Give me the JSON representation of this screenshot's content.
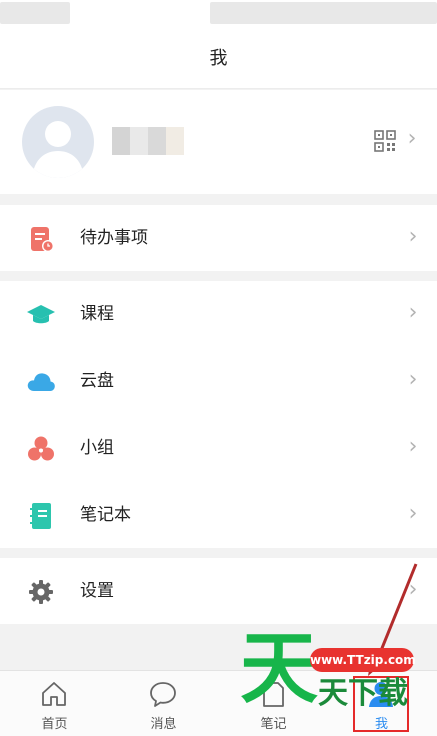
{
  "header": {
    "title": "我"
  },
  "profile": {
    "qr_icon": "qr-code-icon"
  },
  "menu": {
    "todo": {
      "label": "待办事项",
      "icon": "todo-icon",
      "color": "#ef7369"
    },
    "course": {
      "label": "课程",
      "icon": "graduation-cap-icon",
      "color": "#27c0b0"
    },
    "cloud": {
      "label": "云盘",
      "icon": "cloud-icon",
      "color": "#3aa8e6"
    },
    "group": {
      "label": "小组",
      "icon": "group-icon",
      "color": "#ef7369"
    },
    "notebook": {
      "label": "笔记本",
      "icon": "notebook-icon",
      "color": "#2dc6ad"
    },
    "settings": {
      "label": "设置",
      "icon": "gear-icon",
      "color": "#666666"
    }
  },
  "tabbar": {
    "items": [
      {
        "label": "首页",
        "icon": "home-icon"
      },
      {
        "label": "消息",
        "icon": "chat-icon"
      },
      {
        "label": "笔记",
        "icon": "note-icon"
      },
      {
        "label": "我",
        "icon": "user-icon",
        "active": true
      }
    ],
    "accent": "#2a8cf0"
  },
  "watermark": {
    "url": "www.TTzip.com",
    "brand_big": "天",
    "brand_text": "天下载"
  }
}
